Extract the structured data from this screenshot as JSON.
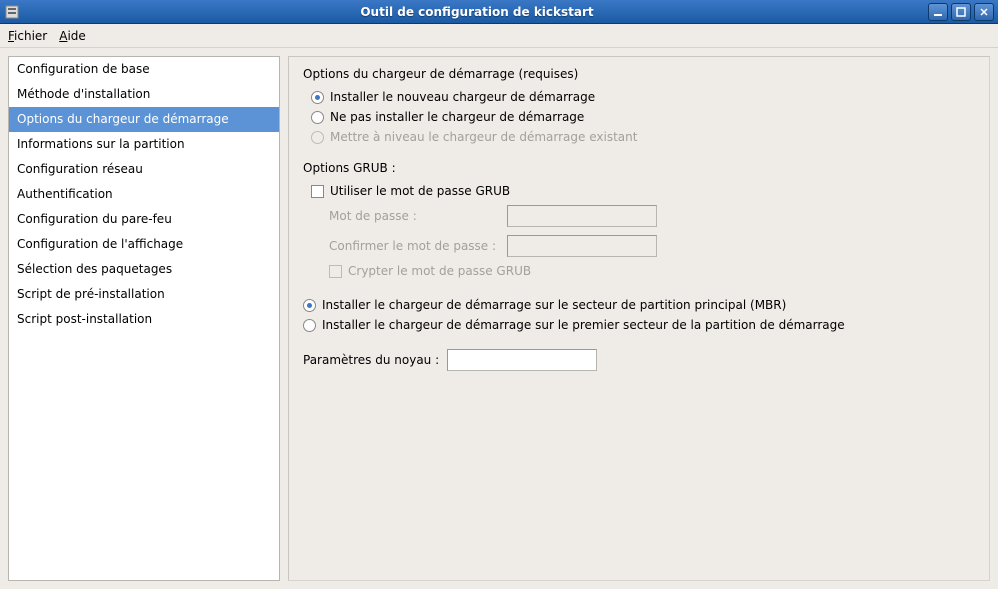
{
  "window": {
    "title": "Outil de configuration de kickstart"
  },
  "menubar": {
    "file": "Fichier",
    "help": "Aide"
  },
  "sidebar": {
    "items": [
      "Configuration de base",
      "Méthode d'installation",
      "Options du chargeur de démarrage",
      "Informations sur la partition",
      "Configuration réseau",
      "Authentification",
      "Configuration du pare-feu",
      "Configuration de l'affichage",
      "Sélection des paquetages",
      "Script de pré-installation",
      "Script post-installation"
    ],
    "selected_index": 2
  },
  "main": {
    "section_required": "Options du chargeur de démarrage (requises)",
    "install_choice": {
      "install_new": "Installer le nouveau chargeur de démarrage",
      "no_install": "Ne pas installer le chargeur de démarrage",
      "upgrade": "Mettre à niveau le chargeur de démarrage existant",
      "selected": "install_new"
    },
    "grub": {
      "title": "Options GRUB :",
      "use_pw": "Utiliser le mot de passe GRUB",
      "pw_label": "Mot de passe :",
      "confirm_label": "Confirmer le mot de passe :",
      "encrypt": "Crypter le mot de passe GRUB"
    },
    "location": {
      "mbr": "Installer le chargeur de démarrage sur le secteur de partition principal (MBR)",
      "first_sector": "Installer le chargeur de démarrage sur le premier secteur de la partition de démarrage",
      "selected": "mbr"
    },
    "kernel": {
      "label": "Paramètres du noyau :",
      "value": ""
    }
  }
}
